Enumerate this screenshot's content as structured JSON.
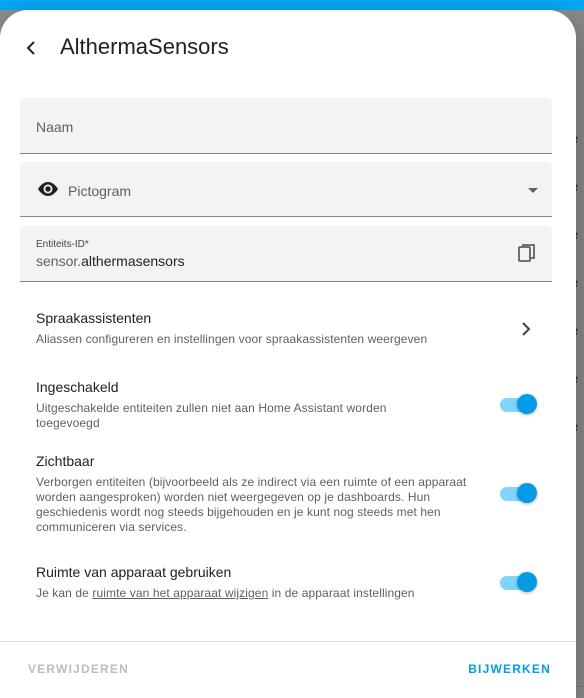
{
  "dialog": {
    "title": "AlthermaSensors"
  },
  "fields": {
    "name_label": "Naam",
    "icon_label": "Pictogram",
    "entity_id_label": "Entiteits-ID*",
    "entity_id_prefix": "sensor.",
    "entity_id_value": "althermasensors"
  },
  "voice": {
    "heading": "Spraakassistenten",
    "desc": "Aliassen configureren en instellingen voor spraakassistenten weergeven"
  },
  "enabled": {
    "heading": "Ingeschakeld",
    "desc": "Uitgeschakelde entiteiten zullen niet aan Home Assistant worden toegevoegd",
    "on": true
  },
  "visible": {
    "heading": "Zichtbaar",
    "desc": "Verborgen entiteiten (bijvoorbeeld als ze indirect via een ruimte of een apparaat worden aangesproken) worden niet weergegeven op je dashboards. Hun geschiedenis wordt nog steeds bijgehouden en je kunt nog steeds met hen communiceren via services.",
    "on": true
  },
  "area": {
    "heading": "Ruimte van apparaat gebruiken",
    "desc_before": "Je kan de ",
    "desc_link": "ruimte van het apparaat wijzigen",
    "desc_after": " in de apparaat instellingen",
    "on": true
  },
  "actions": {
    "delete_label": "VERWIJDEREN",
    "update_label": "BIJWERKEN"
  },
  "background": {
    "letters": [
      "e",
      "e",
      "e",
      "e",
      "e",
      "e",
      "e"
    ]
  },
  "colors": {
    "accent": "#03a9f4",
    "toggle_thumb": "#039be5",
    "toggle_track": "#81d4fa",
    "field_bg": "#f3f3f3"
  },
  "icons": {
    "back": "arrow-left-icon",
    "icon_picker": "eye-icon",
    "dropdown": "caret-down-icon",
    "copy": "copy-icon",
    "voice_open": "chevron-right-icon"
  }
}
